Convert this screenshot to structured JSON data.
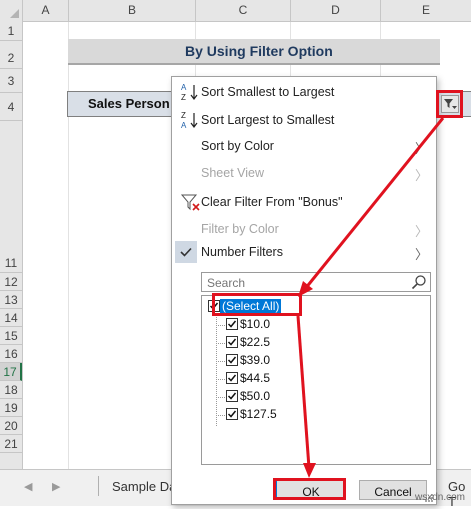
{
  "columns": [
    "A",
    "B",
    "C",
    "D",
    "E"
  ],
  "rows_top": [
    "1",
    "2",
    "3",
    "4"
  ],
  "rows_bottom": [
    "11",
    "12",
    "13",
    "14",
    "15",
    "16",
    "17",
    "18",
    "19",
    "20",
    "21"
  ],
  "active_row": "17",
  "sheet": {
    "title": "By Using Filter Option",
    "header_cell": "Sales Person"
  },
  "tabs": {
    "sheet_tab": "Sample Da",
    "go_tab": "Go T"
  },
  "menu": {
    "sort_asc": "Sort Smallest to Largest",
    "sort_desc": "Sort Largest to Smallest",
    "sort_by_color": "Sort by Color",
    "sheet_view": "Sheet View",
    "clear_filter": "Clear Filter From \"Bonus\"",
    "filter_by_color": "Filter by Color",
    "number_filters": "Number Filters",
    "search_placeholder": "Search",
    "list_items": [
      "(Select All)",
      "$10.0",
      "$22.5",
      "$39.0",
      "$44.5",
      "$50.0",
      "$127.5"
    ],
    "ok": "OK",
    "cancel": "Cancel"
  },
  "icons": {
    "sort_asc": "sort-a-to-z-icon",
    "sort_desc": "sort-z-to-a-icon",
    "clear_filter": "clear-filter-icon",
    "check": "checkmark-icon",
    "search": "magnifier-icon",
    "filter_button": "filter-dropdown-icon"
  },
  "colors": {
    "annotation": "#e0121f",
    "selection": "#0078d7",
    "active_row": "#217346"
  },
  "watermark": "wsxdn.com"
}
